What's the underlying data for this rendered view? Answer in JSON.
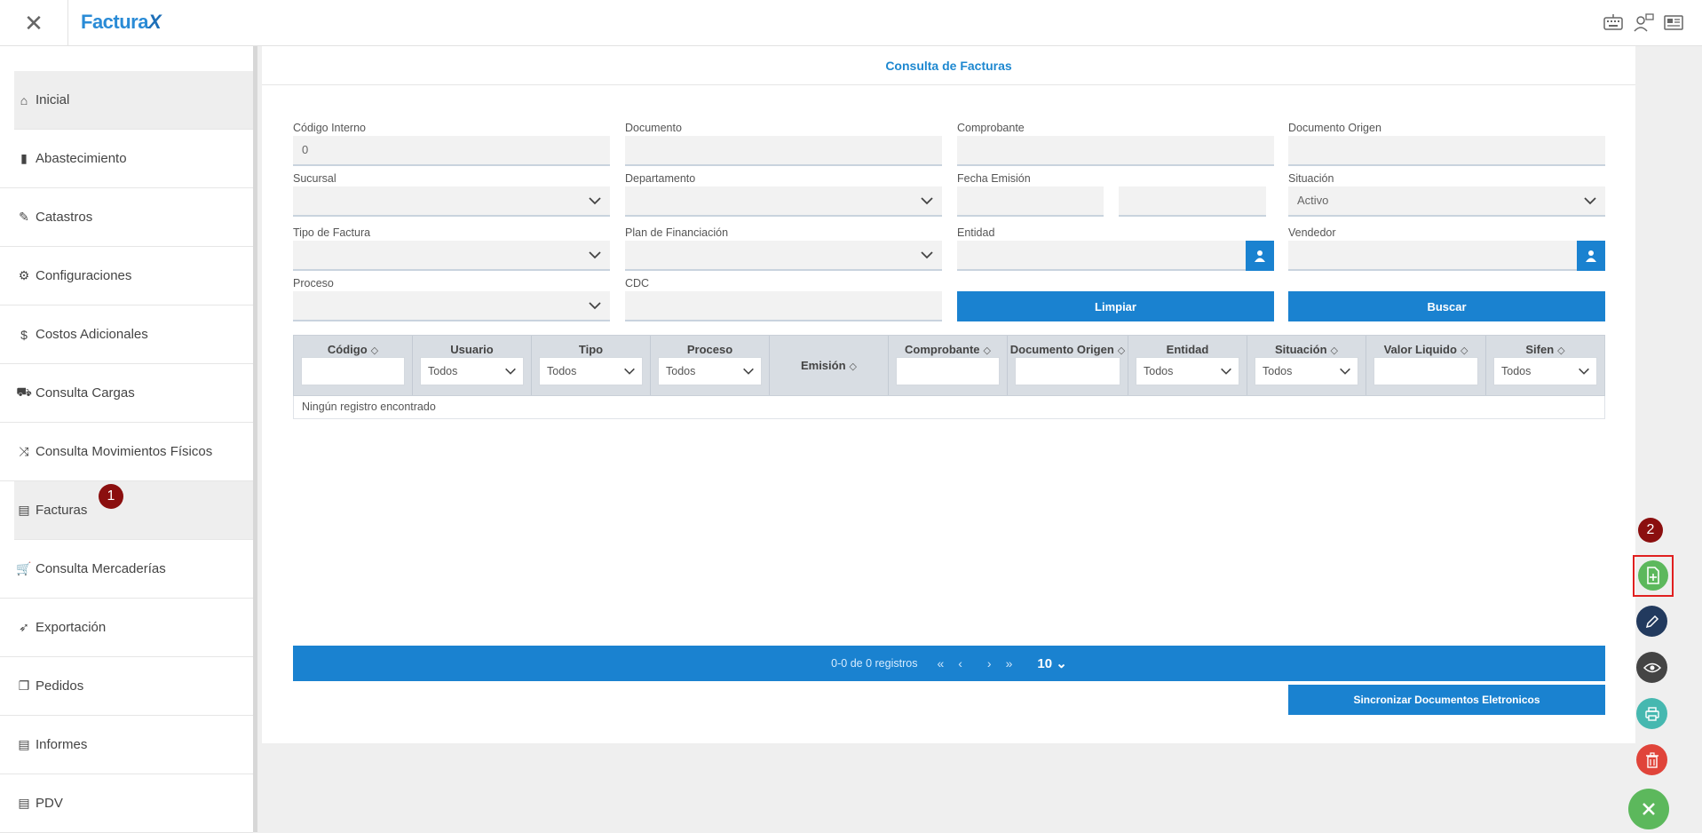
{
  "header": {
    "logo_main": "Factura",
    "logo_x": "X"
  },
  "sidebar": {
    "items": [
      {
        "label": "Inicial",
        "icon": "home-icon"
      },
      {
        "label": "Abastecimiento",
        "icon": "fuel-icon"
      },
      {
        "label": "Catastros",
        "icon": "edit-icon"
      },
      {
        "label": "Configuraciones",
        "icon": "gear-icon"
      },
      {
        "label": "Costos Adicionales",
        "icon": "dollar-icon"
      },
      {
        "label": "Consulta Cargas",
        "icon": "truck-icon"
      },
      {
        "label": "Consulta Movimientos Físicos",
        "icon": "shuffle-icon"
      },
      {
        "label": "Facturas",
        "icon": "document-icon"
      },
      {
        "label": "Consulta Mercaderías",
        "icon": "cart-icon"
      },
      {
        "label": "Exportación",
        "icon": "rocket-icon"
      },
      {
        "label": "Pedidos",
        "icon": "copy-icon"
      },
      {
        "label": "Informes",
        "icon": "file-icon"
      },
      {
        "label": "PDV",
        "icon": "file-icon"
      }
    ],
    "badge_facturas": "1"
  },
  "main": {
    "title": "Consulta de Facturas",
    "fields": {
      "codigo_interno": {
        "label": "Código Interno",
        "value": "0"
      },
      "documento": {
        "label": "Documento",
        "value": ""
      },
      "comprobante": {
        "label": "Comprobante",
        "value": ""
      },
      "documento_origen": {
        "label": "Documento Origen",
        "value": ""
      },
      "sucursal": {
        "label": "Sucursal",
        "value": ""
      },
      "departamento": {
        "label": "Departamento",
        "value": ""
      },
      "fecha_emision": {
        "label": "Fecha Emisión",
        "from": "",
        "to": ""
      },
      "situacion": {
        "label": "Situación",
        "value": "Activo"
      },
      "tipo_factura": {
        "label": "Tipo de Factura",
        "value": ""
      },
      "plan_financiacion": {
        "label": "Plan de Financiación",
        "value": ""
      },
      "entidad": {
        "label": "Entidad",
        "value": ""
      },
      "vendedor": {
        "label": "Vendedor",
        "value": ""
      },
      "proceso": {
        "label": "Proceso",
        "value": ""
      },
      "cdc": {
        "label": "CDC",
        "value": ""
      }
    },
    "buttons": {
      "limpiar": "Limpiar",
      "buscar": "Buscar",
      "sincronizar": "Sincronizar Documentos Eletronicos"
    },
    "table": {
      "columns": [
        {
          "label": "Código",
          "filter": "text",
          "value": "",
          "sort": true
        },
        {
          "label": "Usuario",
          "filter": "select",
          "value": "Todos",
          "sort": false
        },
        {
          "label": "Tipo",
          "filter": "select",
          "value": "Todos",
          "sort": false
        },
        {
          "label": "Proceso",
          "filter": "select",
          "value": "Todos",
          "sort": false
        },
        {
          "label": "Emisión",
          "filter": "none",
          "value": "",
          "sort": true
        },
        {
          "label": "Comprobante",
          "filter": "text",
          "value": "",
          "sort": true
        },
        {
          "label": "Documento Origen",
          "filter": "text",
          "value": "",
          "sort": true
        },
        {
          "label": "Entidad",
          "filter": "select",
          "value": "Todos",
          "sort": false
        },
        {
          "label": "Situación",
          "filter": "select",
          "value": "Todos",
          "sort": true
        },
        {
          "label": "Valor Liquido",
          "filter": "text",
          "value": "",
          "sort": true
        },
        {
          "label": "Sifen",
          "filter": "select",
          "value": "Todos",
          "sort": true
        }
      ],
      "empty_message": "Ningún registro encontrado"
    },
    "pager": {
      "summary": "0-0 de 0 registros",
      "page_size": "10"
    }
  },
  "actions": {
    "badge_new": "2"
  },
  "colors": {
    "accent": "#1a82d0",
    "badge": "#8b0f0f",
    "new": "#5cb85c",
    "edit": "#223a5e",
    "view": "#444",
    "print": "#46b8b0",
    "delete": "#e0443a",
    "close": "#5cb85c"
  }
}
